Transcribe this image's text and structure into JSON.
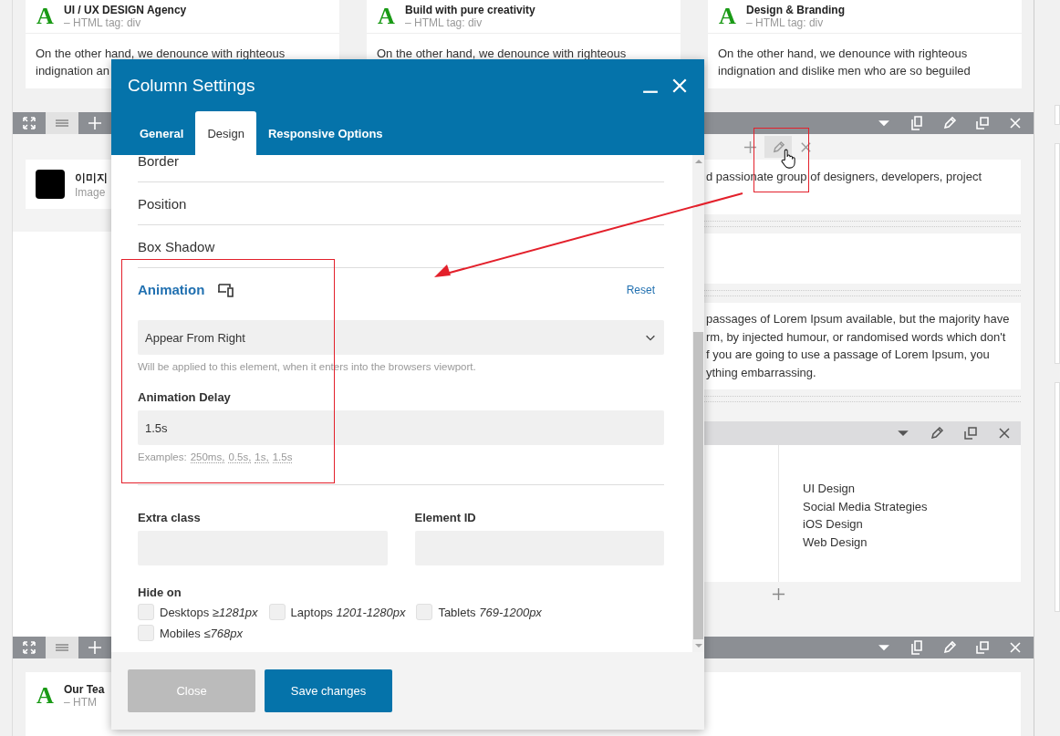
{
  "background": {
    "cards": [
      {
        "icon": "A",
        "title": "UI / UX DESIGN Agency",
        "subtitle": "– HTML tag: div",
        "text_lines": [
          "On the other hand, we denounce with righteous",
          "indignation an"
        ]
      },
      {
        "icon": "A",
        "title": "Build with pure creativity",
        "subtitle": "– HTML tag: div",
        "text_lines": [
          "On the other hand, we denounce with righteous"
        ]
      },
      {
        "icon": "A",
        "title": "Design & Branding",
        "subtitle": "– HTML tag: div",
        "text_lines": [
          "On the other hand, we denounce with righteous",
          "indignation and dislike men who are so beguiled"
        ]
      }
    ],
    "image_element": {
      "title": "이미지",
      "subtitle": "Image"
    },
    "text_block_1": "d passionate group of designers, developers, project",
    "text_block_2": [
      "passages of Lorem Ipsum available, but the majority have",
      "rm, by injected humour, or randomised words which don't",
      "f you are going to use a passage of Lorem Ipsum, you",
      "ything embarrassing."
    ],
    "services": [
      "UI Design",
      "Social Media Strategies",
      "iOS Design",
      "Web Design"
    ],
    "bottom_card": {
      "icon": "A",
      "title": "Our Tea",
      "subtitle": "– HTM"
    }
  },
  "modal": {
    "title": "Column Settings",
    "tabs": [
      {
        "label": "General",
        "selected": false
      },
      {
        "label": "Design",
        "selected": true
      },
      {
        "label": "Responsive Options",
        "selected": false
      }
    ],
    "collapsed_sections": [
      "Border",
      "Position",
      "Box Shadow"
    ],
    "animation": {
      "title": "Animation",
      "reset": "Reset",
      "effect": "Appear From Right",
      "help": "Will be applied to this element, when it enters into the browsers viewport.",
      "delay_label": "Animation Delay",
      "delay_value": "1.5s",
      "examples_label": "Examples:",
      "examples": [
        "250ms,",
        "0.5s,",
        "1s,",
        "1.5s"
      ]
    },
    "extra_class": {
      "label": "Extra class"
    },
    "element_id": {
      "label": "Element ID"
    },
    "hide_on": {
      "label": "Hide on",
      "options": [
        {
          "label": "Desktops *≥1281px*",
          "checked": false
        },
        {
          "label": "Laptops *1201-1280px*",
          "checked": false
        },
        {
          "label": "Tablets *769-1200px*",
          "checked": false
        },
        {
          "label": "Mobiles *≤768px*",
          "checked": false
        }
      ]
    },
    "buttons": [
      {
        "label": "Close",
        "kind": "secondary"
      },
      {
        "label": "Save changes",
        "kind": "primary"
      }
    ]
  }
}
